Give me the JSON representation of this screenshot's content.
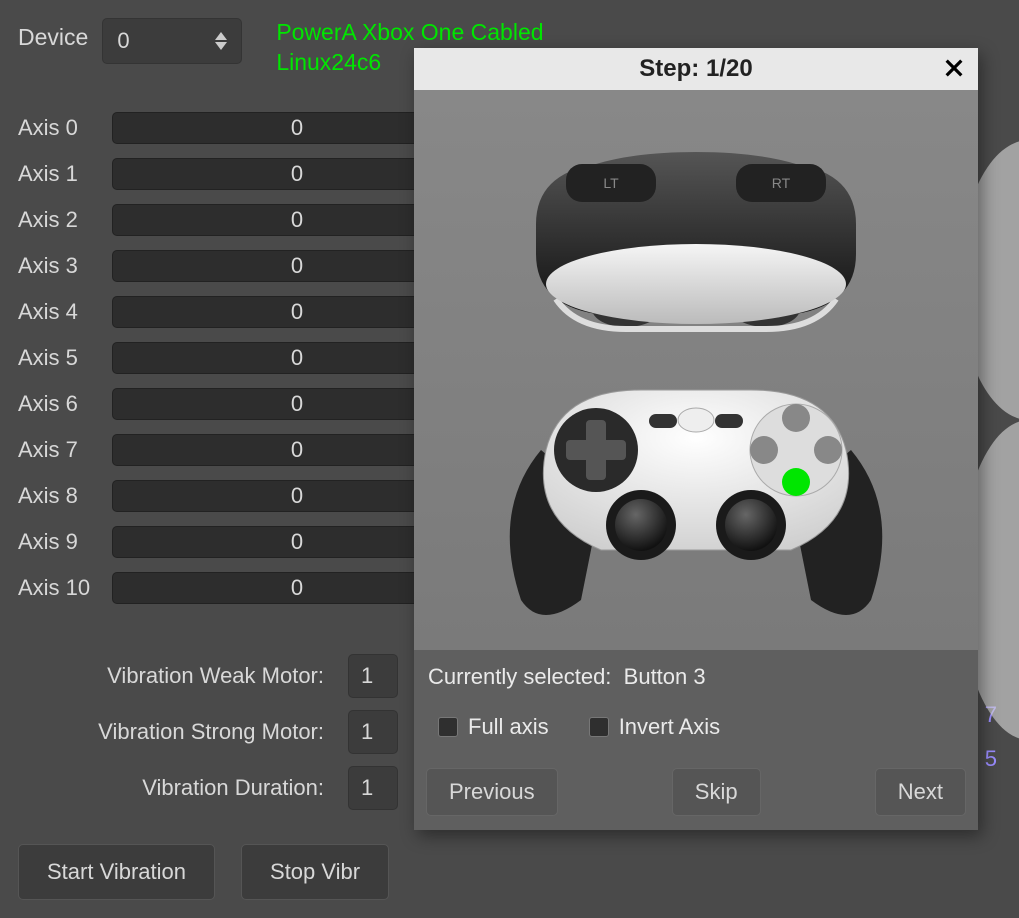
{
  "top": {
    "device_label": "Device",
    "device_value": "0",
    "device_name": "PowerA Xbox One Cabled\nLinux24c6"
  },
  "axes": [
    {
      "label": "Axis 0",
      "value": "0"
    },
    {
      "label": "Axis 1",
      "value": "0"
    },
    {
      "label": "Axis 2",
      "value": "0"
    },
    {
      "label": "Axis 3",
      "value": "0"
    },
    {
      "label": "Axis 4",
      "value": "0"
    },
    {
      "label": "Axis 5",
      "value": "0"
    },
    {
      "label": "Axis 6",
      "value": "0"
    },
    {
      "label": "Axis 7",
      "value": "0"
    },
    {
      "label": "Axis 8",
      "value": "0"
    },
    {
      "label": "Axis 9",
      "value": "0"
    },
    {
      "label": "Axis 10",
      "value": "0"
    }
  ],
  "vibration": {
    "weak_label": "Vibration Weak Motor:",
    "weak_value": "1",
    "strong_label": "Vibration Strong Motor:",
    "strong_value": "1",
    "duration_label": "Vibration Duration:",
    "duration_value": "1",
    "start_btn": "Start Vibration",
    "stop_btn": "Stop Vibr"
  },
  "dialog": {
    "title": "Step: 1/20",
    "currently_selected_label": "Currently selected:",
    "currently_selected_value": "Button 3",
    "full_axis_label": "Full axis",
    "invert_axis_label": "Invert Axis",
    "prev_btn": "Previous",
    "skip_btn": "Skip",
    "next_btn": "Next"
  },
  "bg_markers": {
    "a": "7",
    "b": "5"
  }
}
